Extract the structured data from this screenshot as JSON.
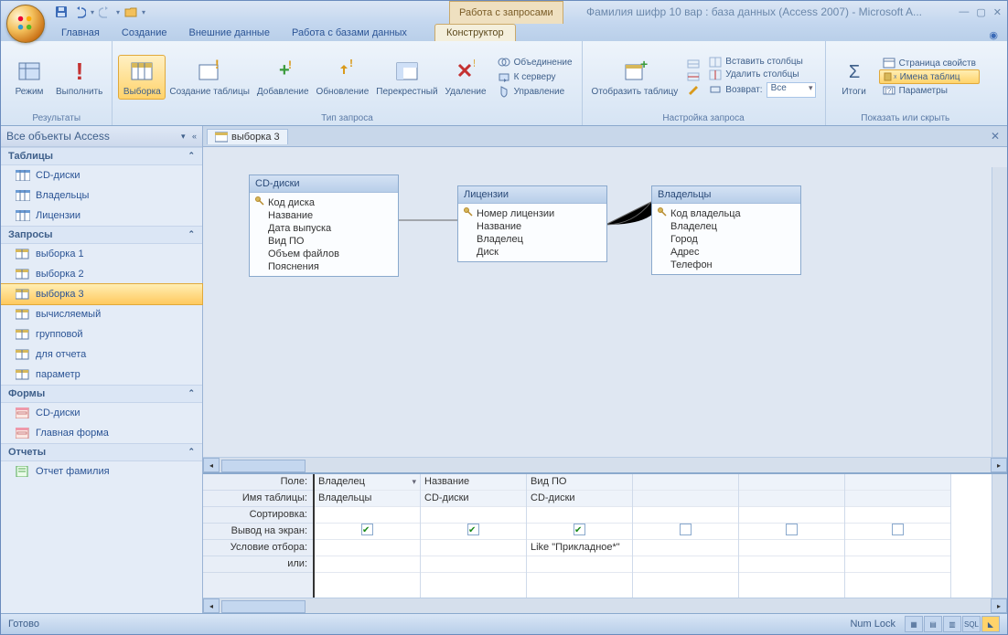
{
  "titlebar": {
    "contextual": "Работа с запросами",
    "title": "Фамилия шифр 10 вар : база данных (Access 2007) - Microsoft A..."
  },
  "tabs": [
    "Главная",
    "Создание",
    "Внешние данные",
    "Работа с базами данных"
  ],
  "context_tab": "Конструктор",
  "ribbon": {
    "g1": {
      "label": "Результаты",
      "btn1": "Режим",
      "btn2": "Выполнить"
    },
    "g2": {
      "label": "Тип запроса",
      "b1": "Выборка",
      "b2": "Создание таблицы",
      "b3": "Добавление",
      "b4": "Обновление",
      "b5": "Перекрестный",
      "b6": "Удаление",
      "r1": "Объединение",
      "r2": "К серверу",
      "r3": "Управление"
    },
    "g3": {
      "label": "Настройка запроса",
      "b1": "Отобразить таблицу",
      "r1": "Вставить столбцы",
      "r2": "Удалить столбцы",
      "r3": "Возврат:",
      "r3v": "Все"
    },
    "g4": {
      "label": "Показать или скрыть",
      "b1": "Итоги",
      "r1": "Страница свойств",
      "r2": "Имена таблиц",
      "r3": "Параметры"
    }
  },
  "nav": {
    "head": "Все объекты Access",
    "g_tables": "Таблицы",
    "t_items": [
      "CD-диски",
      "Владельцы",
      "Лицензии"
    ],
    "g_queries": "Запросы",
    "q_items": [
      "выборка 1",
      "выборка 2",
      "выборка 3",
      "вычисляемый",
      "групповой",
      "для отчета",
      "параметр"
    ],
    "q_sel": 2,
    "g_forms": "Формы",
    "f_items": [
      "CD-диски",
      "Главная форма"
    ],
    "g_reports": "Отчеты",
    "r_items": [
      "Отчет фамилия"
    ]
  },
  "doc": {
    "tab": "выборка 3"
  },
  "tables": {
    "cd": {
      "title": "CD-диски",
      "key": "Код диска",
      "fields": [
        "Название",
        "Дата выпуска",
        "Вид ПО",
        "Объем файлов",
        "Пояснения"
      ]
    },
    "lic": {
      "title": "Лицензии",
      "key": "Номер лицензии",
      "fields": [
        "Название",
        "Владелец",
        "Диск"
      ]
    },
    "own": {
      "title": "Владельцы",
      "key": "Код владельца",
      "fields": [
        "Владелец",
        "Город",
        "Адрес",
        "Телефон"
      ]
    }
  },
  "gridlabels": [
    "Поле:",
    "Имя таблицы:",
    "Сортировка:",
    "Вывод на экран:",
    "Условие отбора:",
    "или:"
  ],
  "gridcols": [
    {
      "field": "Владелец",
      "table": "Владельцы",
      "show": true,
      "cond": ""
    },
    {
      "field": "Название",
      "table": "CD-диски",
      "show": true,
      "cond": ""
    },
    {
      "field": "Вид ПО",
      "table": "CD-диски",
      "show": true,
      "cond": "Like \"Прикладное*\""
    },
    {
      "field": "",
      "table": "",
      "show": false,
      "cond": ""
    },
    {
      "field": "",
      "table": "",
      "show": false,
      "cond": ""
    },
    {
      "field": "",
      "table": "",
      "show": false,
      "cond": ""
    }
  ],
  "status": {
    "left": "Готово",
    "num": "Num Lock"
  }
}
